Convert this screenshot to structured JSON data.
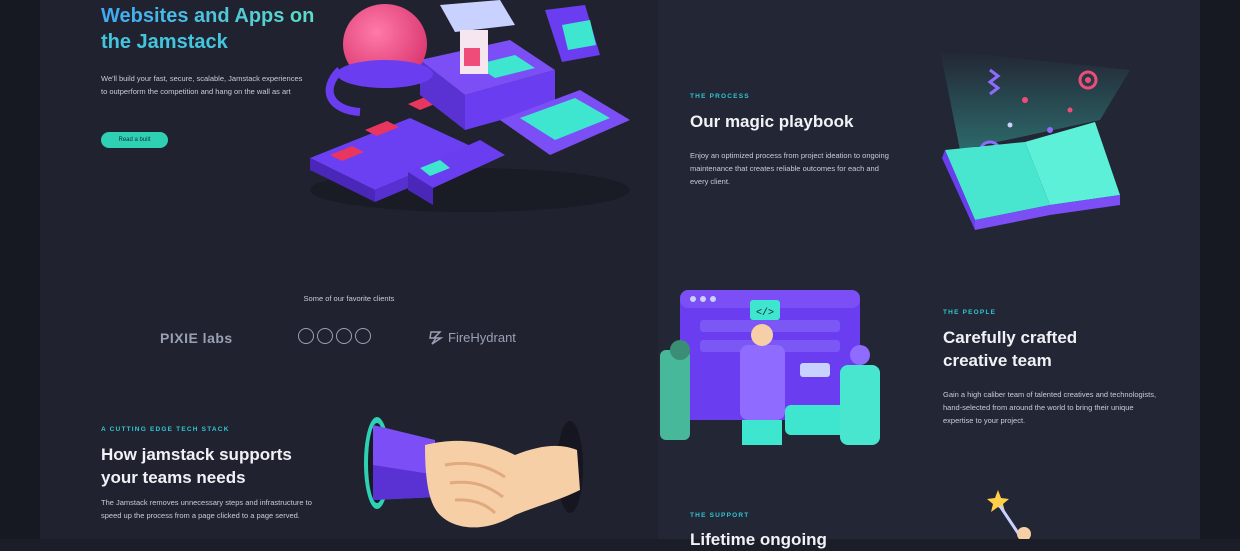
{
  "hero": {
    "title_line1": "Websites and Apps on",
    "title_line2": "the Jamstack",
    "description": "We'll build your fast, secure, scalable, Jamstack experiences to outperform the competition and hang on the wall as art",
    "cta_label": "Read a built"
  },
  "clients": {
    "label": "Some of our favorite clients",
    "logos": [
      "PIXIE labs",
      "FireHydrant"
    ]
  },
  "sections": {
    "tech": {
      "eyebrow": "A CUTTING EDGE TECH STACK",
      "title_line1": "How jamstack supports",
      "title_line2": "your teams needs",
      "description": "The Jamstack removes unnecessary steps and infrastructure to speed up the process from a page clicked to a page served."
    },
    "process": {
      "eyebrow": "THE PROCESS",
      "title": "Our magic playbook",
      "description": "Enjoy an optimized process from project ideation to ongoing maintenance that creates reliable outcomes for each and every client."
    },
    "people": {
      "eyebrow": "THE PEOPLE",
      "title_line1": "Carefully crafted",
      "title_line2": "creative team",
      "description": "Gain a high caliber team of talented creatives and technologists, hand-selected from around the world to bring their unique expertise to your project."
    },
    "support": {
      "eyebrow": "THE SUPPORT",
      "title": "Lifetime ongoing"
    }
  },
  "illustrations": {
    "factory": "isometric-factory-illustration",
    "book": "magic-book-illustration",
    "team": "team-collaboration-illustration",
    "handshake": "handshake-illustration",
    "support": "support-wand-illustration"
  },
  "colors": {
    "background": "#1b1d28",
    "panel_left": "#20232f",
    "panel_right": "#232634",
    "accent_teal": "#2fd1b4",
    "accent_cyan": "#2fc7d4",
    "purple": "#6a3df0",
    "pink": "#f04c7a"
  }
}
